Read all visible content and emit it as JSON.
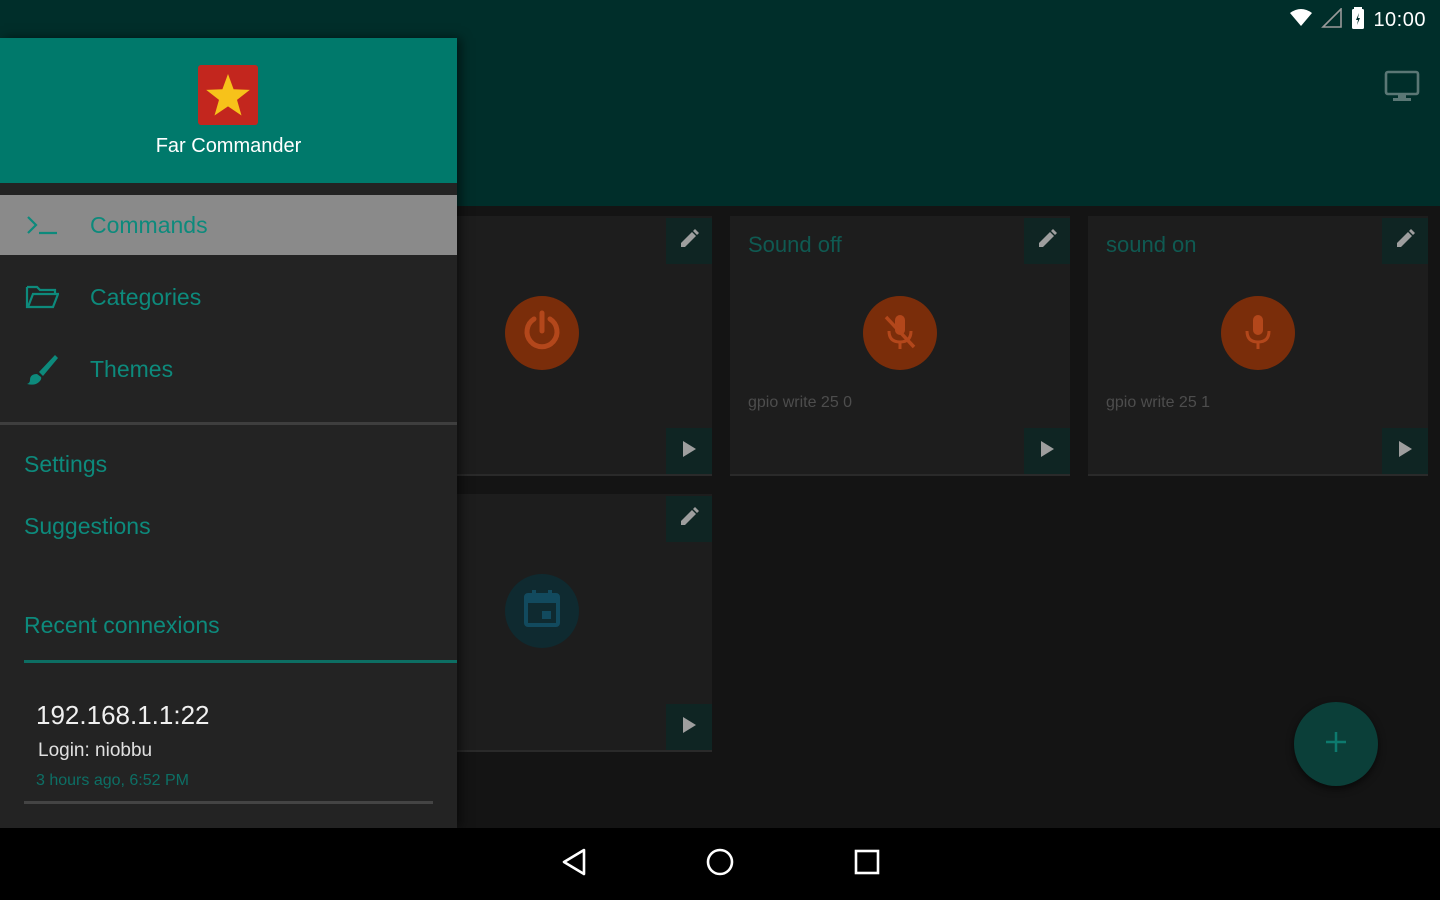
{
  "status_bar": {
    "time": "10:00"
  },
  "app_bar": {
    "monitor_icon": "monitor-icon"
  },
  "cards": [
    {
      "title": "",
      "command": "",
      "icon": "power-icon",
      "circle_color": "#7a2d0a",
      "glyph_color": "#b3471b"
    },
    {
      "title": "Sound off",
      "command": "gpio write 25 0",
      "icon": "mic-off-icon",
      "circle_color": "#7a2d0a",
      "glyph_color": "#b3471b"
    },
    {
      "title": "sound on",
      "command": "gpio write 25 1",
      "icon": "mic-icon",
      "circle_color": "#7a2d0a",
      "glyph_color": "#b3471b"
    },
    {
      "title": "",
      "command": "",
      "icon": "calendar-icon",
      "circle_color": "#0f2a30",
      "glyph_color": "#124a5e"
    }
  ],
  "fab": {
    "icon": "plus-icon"
  },
  "drawer": {
    "header": {
      "app_name": "Far Commander",
      "logo": "star-logo"
    },
    "menu": [
      {
        "label": "Commands",
        "icon": "terminal-icon",
        "active": true
      },
      {
        "label": "Categories",
        "icon": "folder-open-icon",
        "active": false
      },
      {
        "label": "Themes",
        "icon": "brush-icon",
        "active": false
      }
    ],
    "links": [
      {
        "label": "Settings"
      },
      {
        "label": "Suggestions"
      }
    ],
    "recent": {
      "title": "Recent connexions",
      "items": [
        {
          "host": "192.168.1.1:22",
          "login": "Login: niobbu",
          "time": "3 hours ago, 6:52 PM"
        }
      ]
    }
  },
  "colors": {
    "accent": "#00796b",
    "app_bar": "#002e2a",
    "drawer_bg": "#232323",
    "menu_text": "#0d8a7c"
  }
}
